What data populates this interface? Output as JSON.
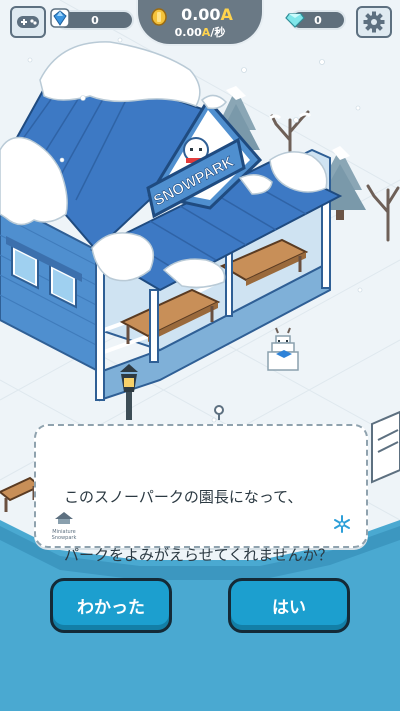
{
  "hud": {
    "gems": "0",
    "money": "0.00",
    "money_unit": "A",
    "rate": "0.00",
    "rate_unit": "A",
    "rate_suffix": "/秒",
    "diamonds": "0"
  },
  "sign": {
    "text": "SNOWPARK"
  },
  "dialog": {
    "line1": "このスノーパークの園長になって、",
    "line2": "パークをよみがえらせてくれませんか？",
    "logo_line1": "Miniature",
    "logo_line2": "Snowpark"
  },
  "buttons": {
    "ok": "わかった",
    "yes": "はい"
  },
  "colors": {
    "accent": "#1c9fcf",
    "roof": "#3d79c4",
    "gold": "#ffd34d"
  },
  "icons": [
    "gamepad-icon",
    "blue-gem-icon",
    "coin-icon",
    "diamond-icon",
    "gear-icon",
    "snowflake-icon"
  ]
}
